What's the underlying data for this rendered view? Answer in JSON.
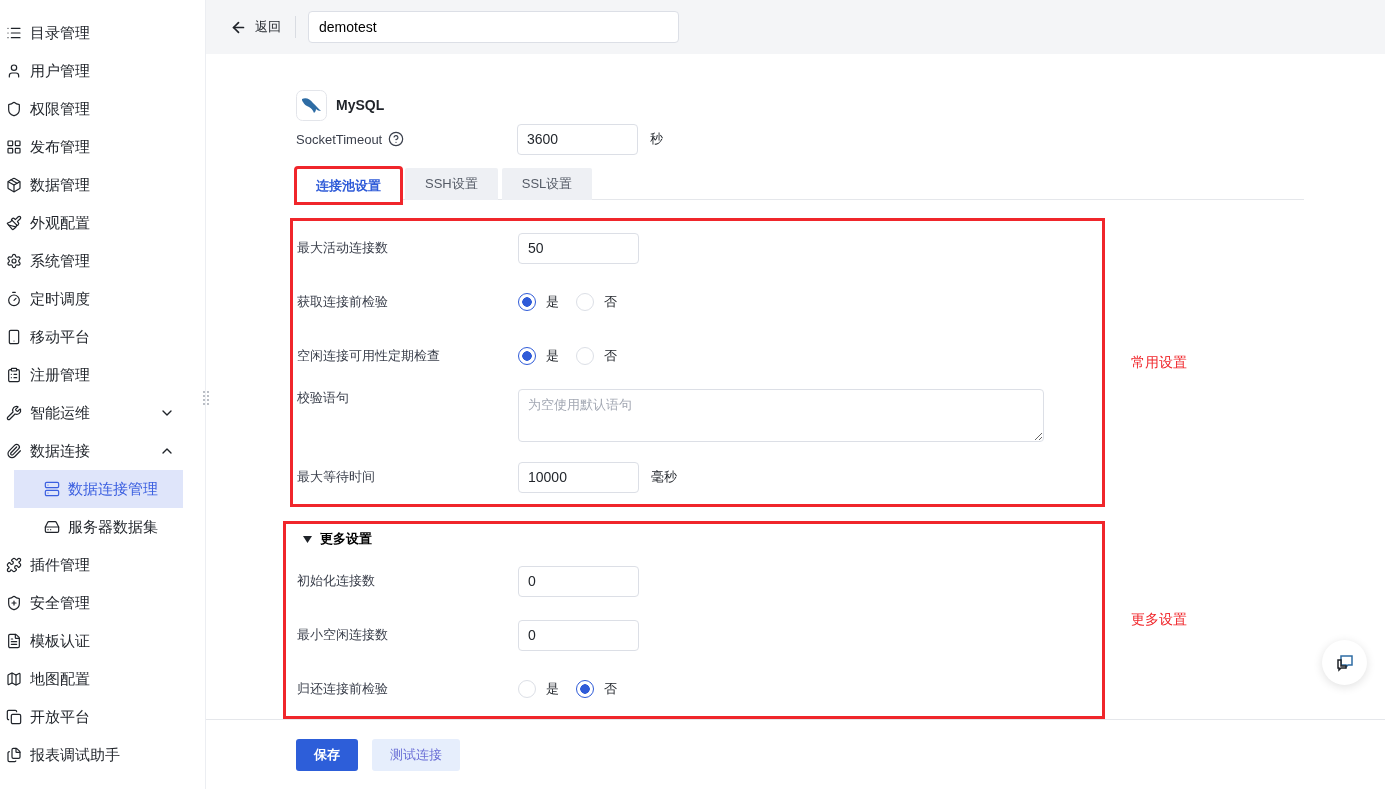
{
  "sidebar": {
    "items": [
      {
        "label": "目录管理",
        "selected": false
      },
      {
        "label": "用户管理",
        "selected": false
      },
      {
        "label": "权限管理",
        "selected": false
      },
      {
        "label": "发布管理",
        "selected": false
      },
      {
        "label": "数据管理",
        "selected": false
      },
      {
        "label": "外观配置",
        "selected": false
      },
      {
        "label": "系统管理",
        "selected": false
      },
      {
        "label": "定时调度",
        "selected": false
      },
      {
        "label": "移动平台",
        "selected": false
      },
      {
        "label": "注册管理",
        "selected": false
      },
      {
        "label": "智能运维",
        "selected": false,
        "expanded": false
      },
      {
        "label": "数据连接",
        "selected": false,
        "expanded": true,
        "children": [
          {
            "label": "数据连接管理",
            "selected": true
          },
          {
            "label": "服务器数据集",
            "selected": false
          }
        ]
      },
      {
        "label": "插件管理",
        "selected": false
      },
      {
        "label": "安全管理",
        "selected": false
      },
      {
        "label": "模板认证",
        "selected": false
      },
      {
        "label": "地图配置",
        "selected": false
      },
      {
        "label": "开放平台",
        "selected": false
      },
      {
        "label": "报表调试助手",
        "selected": false
      }
    ]
  },
  "header": {
    "back": "返回",
    "name": "demotest"
  },
  "datasource": {
    "name": "MySQL"
  },
  "socket_timeout": {
    "label": "SocketTimeout",
    "value": "3600",
    "unit": "秒"
  },
  "tabs": [
    {
      "label": "连接池设置",
      "selected": true,
      "annotated": true
    },
    {
      "label": "SSH设置",
      "selected": false,
      "annotated": false
    },
    {
      "label": "SSL设置",
      "selected": false,
      "annotated": false
    }
  ],
  "sections": [
    {
      "annotation": "常用设置",
      "rows": [
        {
          "kind": "input",
          "label": "最大活动连接数",
          "value": "50"
        },
        {
          "kind": "radio",
          "label": "获取连接前检验",
          "options": [
            {
              "label": "是",
              "selected": true
            },
            {
              "label": "否",
              "selected": false
            }
          ]
        },
        {
          "kind": "radio",
          "label": "空闲连接可用性定期检查",
          "options": [
            {
              "label": "是",
              "selected": true
            },
            {
              "label": "否",
              "selected": false
            }
          ]
        },
        {
          "kind": "textarea",
          "label": "校验语句",
          "placeholder": "为空使用默认语句"
        },
        {
          "kind": "input",
          "label": "最大等待时间",
          "value": "10000",
          "unit": "毫秒"
        }
      ]
    },
    {
      "annotation": "更多设置",
      "heading": {
        "label": "更多设置",
        "expanded": true
      },
      "rows": [
        {
          "kind": "input",
          "label": "初始化连接数",
          "value": "0"
        },
        {
          "kind": "input",
          "label": "最小空闲连接数",
          "value": "0"
        },
        {
          "kind": "radio",
          "label": "归还连接前检验",
          "options": [
            {
              "label": "是",
              "selected": false
            },
            {
              "label": "否",
              "selected": true
            }
          ]
        }
      ]
    }
  ],
  "buttons": [
    {
      "label": "保存",
      "kind": "primary"
    },
    {
      "label": "测试连接",
      "kind": "secondary"
    }
  ]
}
